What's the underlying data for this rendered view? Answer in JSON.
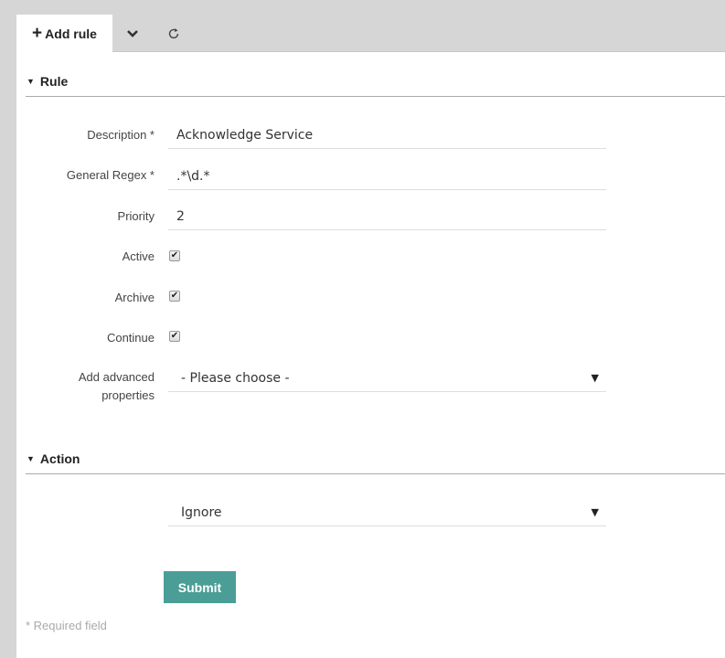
{
  "tabs": {
    "add_rule": {
      "icon": "plus-icon",
      "label": "Add rule"
    },
    "dropdown_icon": "chevron-down-icon",
    "refresh_icon": "refresh-icon"
  },
  "rule_section": {
    "title": "Rule",
    "fields": {
      "description": {
        "label": "Description *",
        "value": "Acknowledge Service"
      },
      "general_regex": {
        "label": "General Regex *",
        "value": ".*\\d.*"
      },
      "priority": {
        "label": "Priority",
        "value": "2"
      },
      "active": {
        "label": "Active",
        "checked": true
      },
      "archive": {
        "label": "Archive",
        "checked": true
      },
      "continue": {
        "label": "Continue",
        "checked": true
      },
      "advanced": {
        "label_line1": "Add advanced",
        "label_line2": "properties",
        "selected": "- Please choose -"
      }
    }
  },
  "action_section": {
    "title": "Action",
    "selected": "Ignore"
  },
  "submit_label": "Submit",
  "required_note": "* Required field",
  "colors": {
    "accent": "#4a9e96",
    "background": "#d6d6d6"
  }
}
